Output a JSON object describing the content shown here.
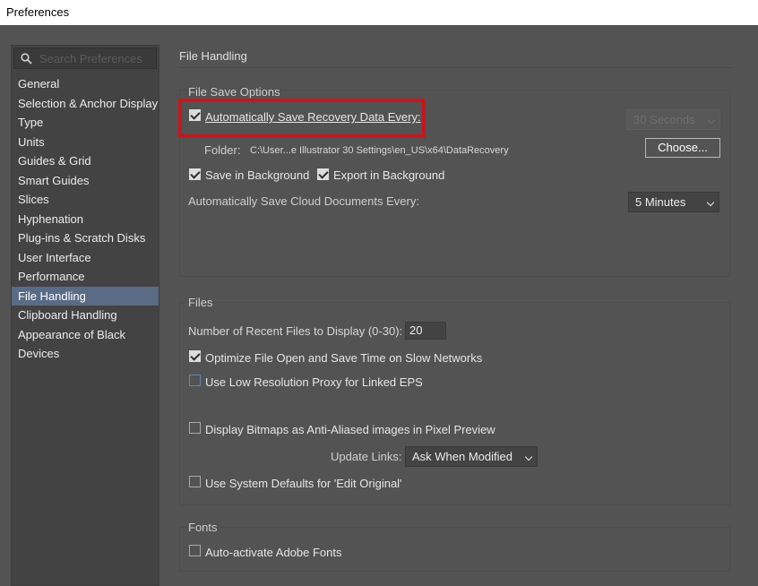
{
  "window": {
    "title": "Preferences"
  },
  "sidebar": {
    "search_placeholder": "Search Preferences",
    "items": [
      {
        "label": "General",
        "active": false
      },
      {
        "label": "Selection & Anchor Display",
        "active": false
      },
      {
        "label": "Type",
        "active": false
      },
      {
        "label": "Units",
        "active": false
      },
      {
        "label": "Guides & Grid",
        "active": false
      },
      {
        "label": "Smart Guides",
        "active": false
      },
      {
        "label": "Slices",
        "active": false
      },
      {
        "label": "Hyphenation",
        "active": false
      },
      {
        "label": "Plug-ins & Scratch Disks",
        "active": false
      },
      {
        "label": "User Interface",
        "active": false
      },
      {
        "label": "Performance",
        "active": false
      },
      {
        "label": "File Handling",
        "active": true
      },
      {
        "label": "Clipboard Handling",
        "active": false
      },
      {
        "label": "Appearance of Black",
        "active": false
      },
      {
        "label": "Devices",
        "active": false
      }
    ]
  },
  "main": {
    "title": "File Handling",
    "file_save_options": {
      "title": "File Save Options",
      "auto_save": {
        "label": "Automatically Save Recovery Data Every:",
        "checked": true
      },
      "interval": {
        "value": "30 Seconds",
        "disabled": true
      },
      "folder_label": "Folder:",
      "folder_path": "C:\\User...e Illustrator 30 Settings\\en_US\\x64\\DataRecovery",
      "choose_button": "Choose...",
      "save_in_background": {
        "label": "Save in Background",
        "checked": true
      },
      "export_in_background": {
        "label": "Export in Background",
        "checked": true
      },
      "cloud_label": "Automatically Save Cloud Documents Every:",
      "cloud_interval": "5 Minutes"
    },
    "files": {
      "title": "Files",
      "recent_files_label": "Number of Recent Files to Display (0-30):",
      "recent_files_value": "20",
      "optimize": {
        "label": "Optimize File Open and Save Time on Slow Networks",
        "checked": true
      },
      "low_res_proxy": {
        "label": "Use Low Resolution Proxy for Linked EPS",
        "checked": false
      },
      "anti_aliased": {
        "label": "Display Bitmaps as Anti-Aliased images in Pixel Preview",
        "checked": false
      },
      "update_links_label": "Update Links:",
      "update_links_value": "Ask When Modified",
      "system_defaults": {
        "label": "Use System Defaults for 'Edit Original'",
        "checked": false
      }
    },
    "fonts": {
      "title": "Fonts",
      "auto_activate": {
        "label": "Auto-activate Adobe Fonts",
        "checked": false
      }
    }
  },
  "colors": {
    "highlight": "#c8161d",
    "active_item": "#5a6b85",
    "panel_bg": "#535353"
  }
}
